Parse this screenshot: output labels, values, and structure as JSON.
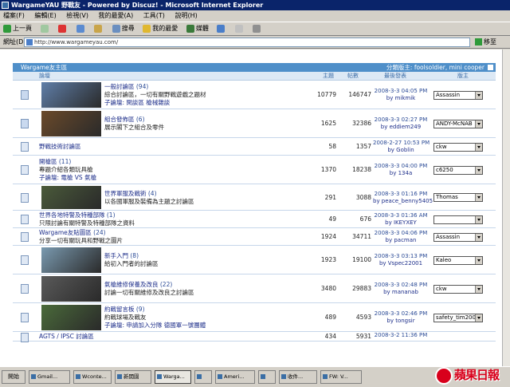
{
  "window": {
    "title": "WargameYAU 野戰友 - Powered by Discuz! - Microsoft Internet Explorer"
  },
  "menu": [
    "檔案(F)",
    "編輯(E)",
    "檢視(V)",
    "我的最愛(A)",
    "工具(T)",
    "說明(H)"
  ],
  "toolbar": {
    "back": "上一頁",
    "search": "搜尋",
    "favorites": "我的最愛",
    "media": "媒體"
  },
  "address": {
    "label": "網址(D)",
    "url": "http://www.wargameyau.com/",
    "go": "移至",
    "links": "連結"
  },
  "forum": {
    "title": "Wargame友主區",
    "moderators": "分類版主: foolsoldier, mini cooper",
    "columns": {
      "forum": "論壇",
      "topics": "主題",
      "posts": "帖數",
      "last": "最後發表",
      "mods": "版主"
    },
    "rows": [
      {
        "name": "一般討論區",
        "count": "(94)",
        "desc": "綜合討論區，一切有關野戰遊戲之題材",
        "sub": "子論壇: 閑談區 槍械雜談",
        "topics": "10779",
        "posts": "146747",
        "date": "2008-3-3 04:05 PM",
        "by": "by mikmik",
        "mod": "Assassin"
      },
      {
        "name": "組合發佈區",
        "count": "(6)",
        "desc": "展示閣下之組合及零件",
        "sub": "",
        "topics": "1625",
        "posts": "32386",
        "date": "2008-3-3 02:27 PM",
        "by": "by eddiem249",
        "mod": "ANDY-McNAB"
      },
      {
        "name": "野戰技術討論區",
        "count": "",
        "desc": "",
        "sub": "",
        "topics": "58",
        "posts": "1357",
        "date": "2008-2-27 10:53 PM",
        "by": "by Goblin",
        "mod": "ckw"
      },
      {
        "name": "開槍區",
        "count": "(11)",
        "desc": "專題介紹各類玩具槍",
        "sub": "子論壇: 電槍 VS 氣槍",
        "topics": "1370",
        "posts": "18238",
        "date": "2008-3-3 04:00 PM",
        "by": "by 134a",
        "mod": "c6250"
      },
      {
        "name": "世界軍服及戰術",
        "count": "(4)",
        "desc": "以各國軍服及裝備為主題之討論區",
        "sub": "",
        "topics": "291",
        "posts": "3088",
        "date": "2008-3-3 01:16 PM",
        "by": "by peace_benny5405",
        "mod": "Thomas"
      },
      {
        "name": "世界各地特警及特種部隊",
        "count": "(1)",
        "desc": "只限討論有關特警及特種部隊之資料",
        "sub": "",
        "topics": "49",
        "posts": "676",
        "date": "2008-3-3 01:36 AM",
        "by": "by IKEYXEY",
        "mod": ""
      },
      {
        "name": "Wargame友貼圖區",
        "count": "(24)",
        "desc": "分享一切有關玩具和野戰之圖片",
        "sub": "",
        "topics": "1924",
        "posts": "34711",
        "date": "2008-3-3 04:06 PM",
        "by": "by pacman",
        "mod": "Assassin"
      },
      {
        "name": "新手入門",
        "count": "(8)",
        "desc": "給初入門者的討論區",
        "sub": "",
        "topics": "1923",
        "posts": "19100",
        "date": "2008-3-3 03:13 PM",
        "by": "by Vspec22001",
        "mod": "Kaleo"
      },
      {
        "name": "氣槍維修保養及改良",
        "count": "(22)",
        "desc": "討論一切有關維修及改良之討論區",
        "sub": "",
        "topics": "3480",
        "posts": "29883",
        "date": "2008-3-3 02:48 PM",
        "by": "by mananab",
        "mod": "ckw"
      },
      {
        "name": "約戰留言板",
        "count": "(9)",
        "desc": "約戰球場及戰友",
        "sub": "子論壇: 申請加入分隊 德國軍一號團體",
        "topics": "489",
        "posts": "4593",
        "date": "2008-3-3 02:46 PM",
        "by": "by tongsir",
        "mod": "safety_tim200"
      },
      {
        "name": "AGTS / IPSC 討論區",
        "count": "",
        "desc": "",
        "sub": "",
        "topics": "434",
        "posts": "5931",
        "date": "2008-3-2 11:36 PM",
        "by": "",
        "mod": ""
      }
    ]
  },
  "taskbar": {
    "start": "開始",
    "items": [
      "Gmail...",
      "Wconte...",
      "新開園",
      "Warga...",
      "",
      "Ameri...",
      "",
      "收件...",
      "FW: V..."
    ]
  },
  "watermark": "蘋果日報"
}
